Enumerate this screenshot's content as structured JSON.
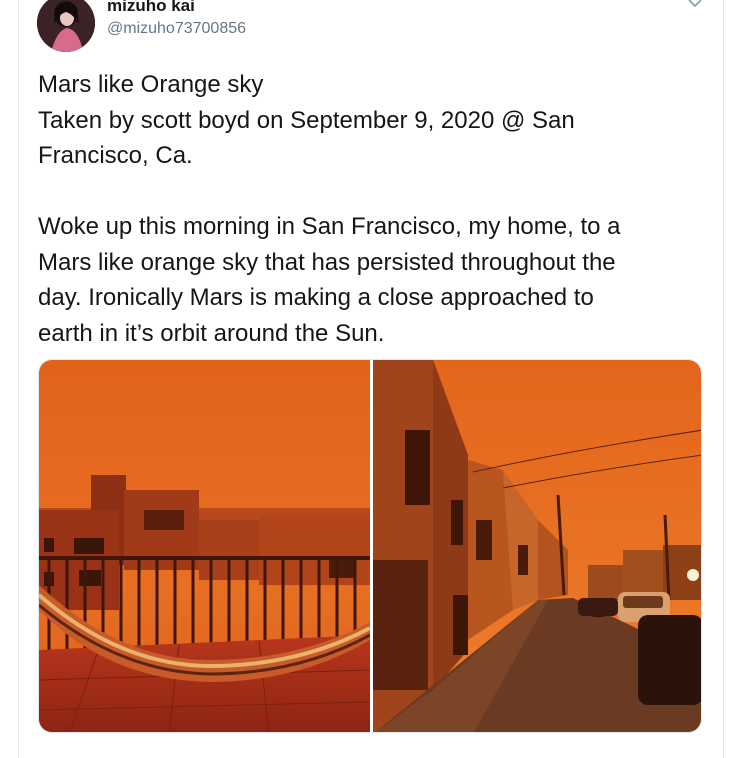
{
  "tweet": {
    "display_name": "mizuho kai",
    "handle": "@mizuho73700856",
    "text_lines": [
      "Mars like Orange sky",
      "Taken by scott boyd on September 9, 2020 @ San",
      "Francisco, Ca.",
      "",
      "Woke up this morning in San Francisco, my home, to a",
      "Mars like orange sky that has persisted throughout the",
      "day. Ironically Mars is making a close approached to",
      "earth in it’s orbit around the Sun."
    ]
  },
  "icons": {
    "avatar": "profile-photo",
    "menu": "chevron-down-icon"
  },
  "colors": {
    "sky_orange": "#e0651a",
    "text": "#14171a",
    "secondary_text": "#657786"
  }
}
